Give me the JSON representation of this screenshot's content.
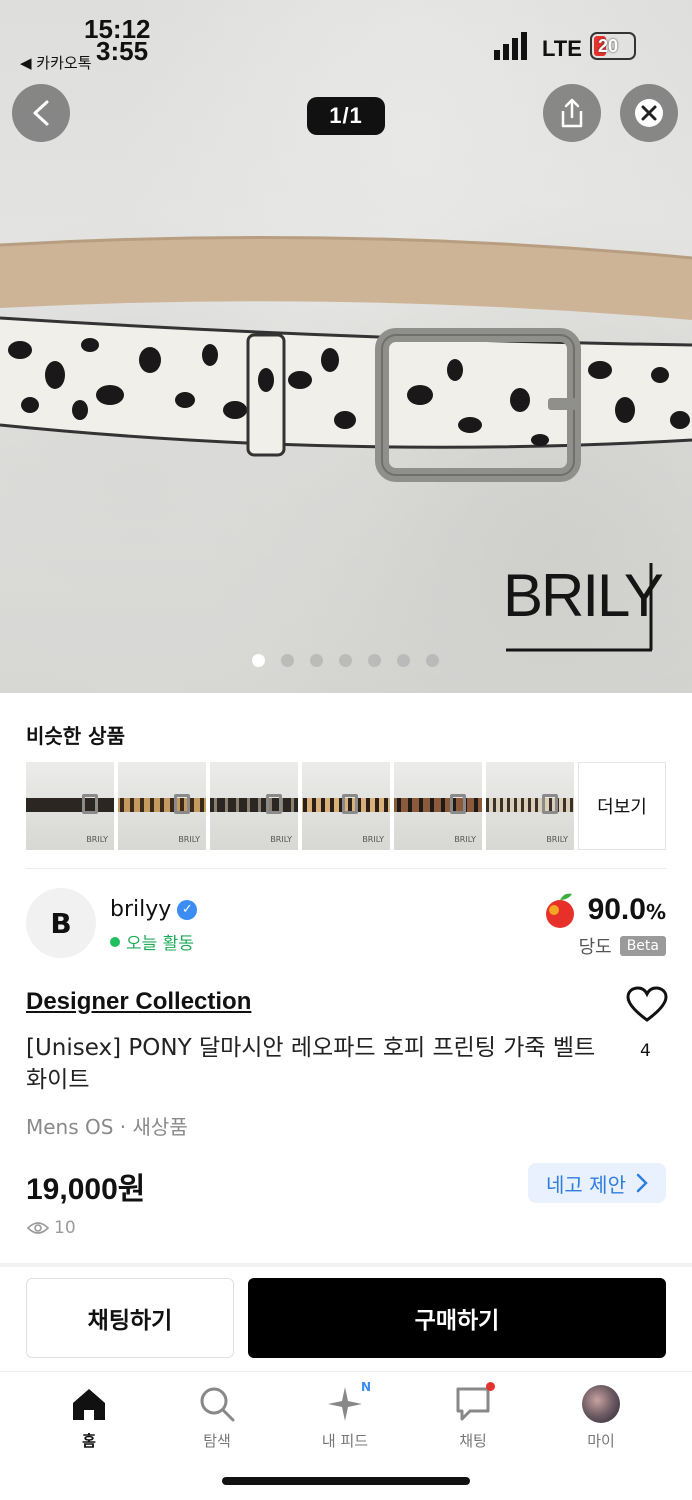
{
  "status_bar": {
    "time_top": "15:12",
    "time_bottom": "3:55",
    "back_app": "◀ 카카오톡",
    "network": "LTE",
    "battery": "20"
  },
  "gallery": {
    "counter": "1/1",
    "watermark": "BRILY",
    "dots": 7,
    "active_dot": 0
  },
  "similar": {
    "title": "비슷한 상품",
    "more_label": "더보기",
    "thumb_count": 6
  },
  "seller": {
    "avatar_letter": "B",
    "name": "brilyy",
    "activity": "오늘 활동",
    "score": "90.0",
    "score_unit": "%",
    "score_label": "당도",
    "beta": "Beta"
  },
  "product": {
    "brand": "Designer Collection",
    "title": "[Unisex] PONY 달마시안 레오파드 호피 프린팅 가죽 벨트 화이트",
    "meta": "Mens OS · 새상품",
    "price": "19,000원",
    "offer_label": "네고 제안",
    "views": "10",
    "likes": "4"
  },
  "actions": {
    "chat": "채팅하기",
    "buy": "구매하기"
  },
  "tabbar": {
    "items": [
      {
        "label": "홈"
      },
      {
        "label": "탐색"
      },
      {
        "label": "내 피드",
        "badge": "N"
      },
      {
        "label": "채팅"
      },
      {
        "label": "마이"
      }
    ]
  },
  "colors": {
    "accent_blue": "#2f7de1",
    "active_green": "#1faa59",
    "buy_bg": "#000000"
  }
}
